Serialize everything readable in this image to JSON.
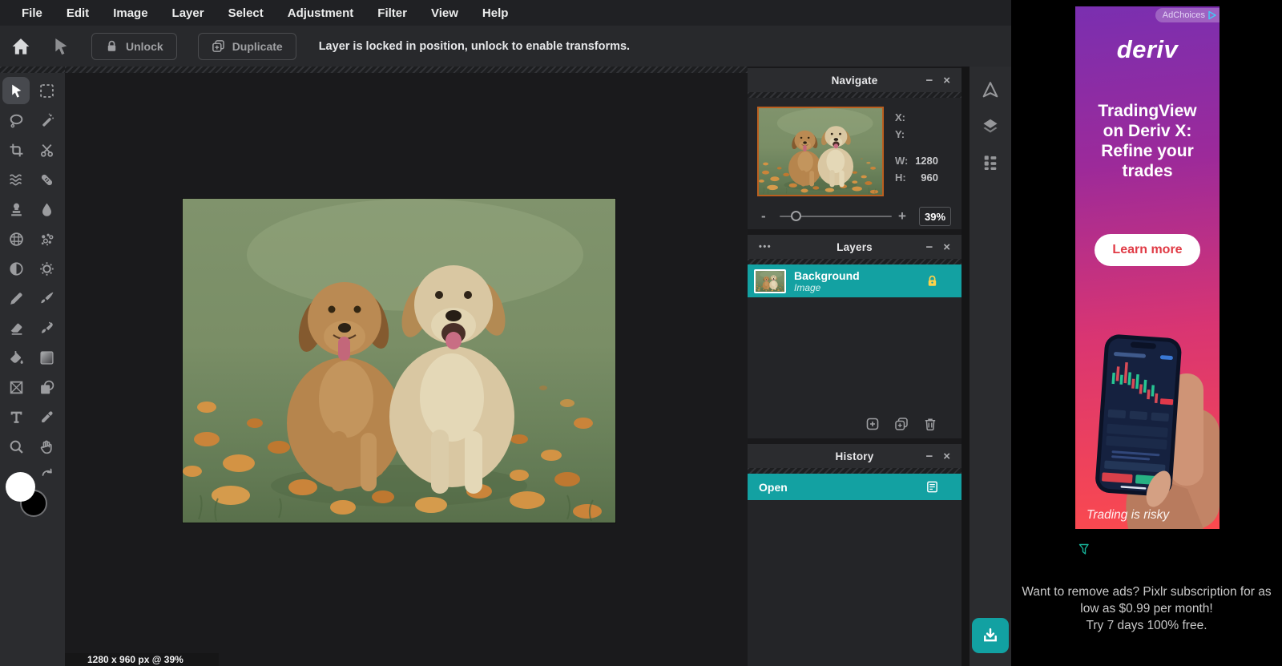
{
  "menu": {
    "items": [
      "File",
      "Edit",
      "Image",
      "Layer",
      "Select",
      "Adjustment",
      "Filter",
      "View",
      "Help"
    ]
  },
  "toolbar": {
    "unlock_label": "Unlock",
    "duplicate_label": "Duplicate",
    "message": "Layer is locked in position, unlock to enable transforms."
  },
  "tools": {
    "selected": "pointer",
    "icon_names": [
      "pointer-icon",
      "marquee-icon",
      "lasso-icon",
      "magic-wand-icon",
      "crop-icon",
      "scissors-icon",
      "liquify-icon",
      "heal-bandage-icon",
      "clone-stamp-icon",
      "blur-drop-icon",
      "halftone-icon",
      "dispersion-bubbles-icon",
      "dodge-half-circle-icon",
      "burn-sun-icon",
      "pen-icon",
      "brush-icon",
      "eraser-icon",
      "smudge-brush-icon",
      "fill-bucket-icon",
      "gradient-icon",
      "frame-icon",
      "shape-icon",
      "text-icon",
      "eyedropper-icon",
      "zoom-icon",
      "hand-icon"
    ],
    "foreground_color": "#ffffff",
    "background_color": "#000000"
  },
  "panel_controls": {
    "minimize": "−",
    "close": "×",
    "menu_dots": "•••"
  },
  "navigate": {
    "title": "Navigate",
    "x_label": "X:",
    "x_value": "",
    "y_label": "Y:",
    "y_value": "",
    "w_label": "W:",
    "w_value": "1280",
    "h_label": "H:",
    "h_value": "960",
    "zoom_out": "-",
    "zoom_in": "+",
    "zoom_value": "39%"
  },
  "layers": {
    "title": "Layers",
    "rows": [
      {
        "name": "Background",
        "type": "Image",
        "locked": true
      }
    ]
  },
  "history": {
    "title": "History",
    "items": [
      {
        "label": "Open"
      }
    ]
  },
  "statusbar": {
    "text": "1280 x 960 px @ 39%"
  },
  "ad": {
    "adchoices_label": "AdChoices",
    "brand": "deriv",
    "headline_lines": [
      "TradingView",
      "on Deriv X:",
      "Refine your",
      "trades"
    ],
    "cta_label": "Learn more",
    "disclaimer": "Trading is risky"
  },
  "promo": {
    "lines": [
      "Want to remove ads? Pixlr subscription for as",
      "low as $0.99 per month!",
      "Try 7 days 100% free."
    ]
  },
  "colors": {
    "accent_teal": "#13a1a2",
    "lock_yellow": "#ffd24a",
    "selection_border": "#bb5f1f",
    "ad_gradient_top": "#7a2fb0",
    "ad_gradient_bottom": "#fb4a4e",
    "cta_text": "#e03a45"
  }
}
